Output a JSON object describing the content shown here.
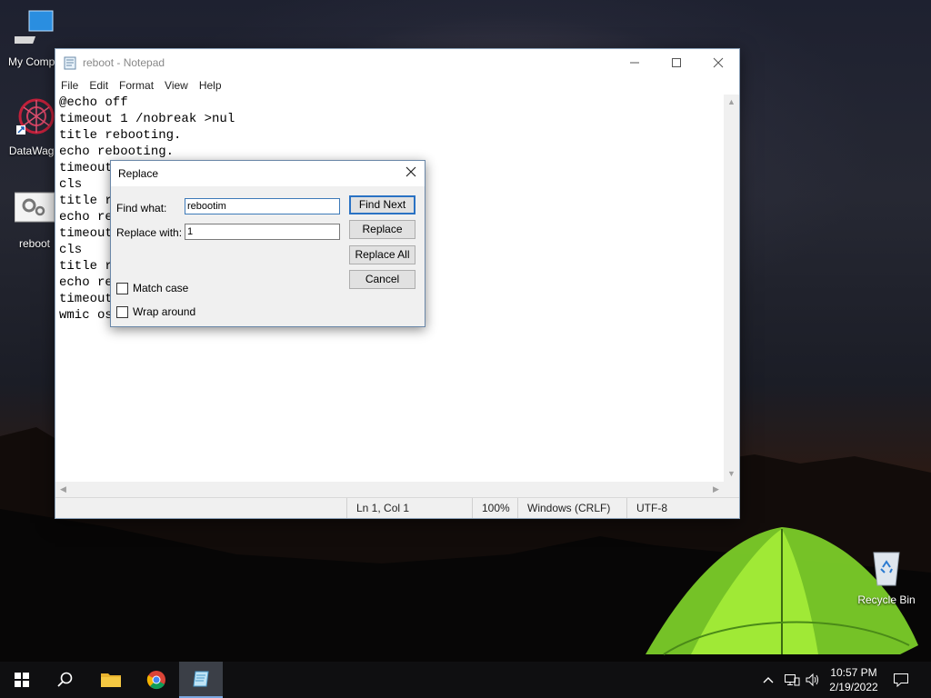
{
  "desktop": {
    "icons": [
      {
        "label": "My Compu"
      },
      {
        "label": "DataWago"
      },
      {
        "label": "reboot"
      },
      {
        "label": "Recycle Bin"
      }
    ]
  },
  "notepad": {
    "title": "reboot - Notepad",
    "menu": [
      "File",
      "Edit",
      "Format",
      "View",
      "Help"
    ],
    "lines": [
      "@echo off",
      "timeout 1 /nobreak >nul",
      "title rebooting.",
      "echo rebooting.",
      "timeout",
      "cls",
      "title r",
      "echo re",
      "timeout",
      "cls",
      "title r",
      "echo re",
      "timeout",
      "wmic os"
    ],
    "status": {
      "position": "Ln 1, Col 1",
      "zoom": "100%",
      "line_ending": "Windows (CRLF)",
      "encoding": "UTF-8"
    }
  },
  "replace_dialog": {
    "title": "Replace",
    "find_label": "Find what:",
    "find_value": "rebootim",
    "replace_label": "Replace with:",
    "replace_value": "1",
    "buttons": {
      "find_next": "Find Next",
      "replace": "Replace",
      "replace_all": "Replace All",
      "cancel": "Cancel"
    },
    "match_case": "Match case",
    "wrap_around": "Wrap around"
  },
  "taskbar": {
    "time": "10:57 PM",
    "date": "2/19/2022"
  }
}
